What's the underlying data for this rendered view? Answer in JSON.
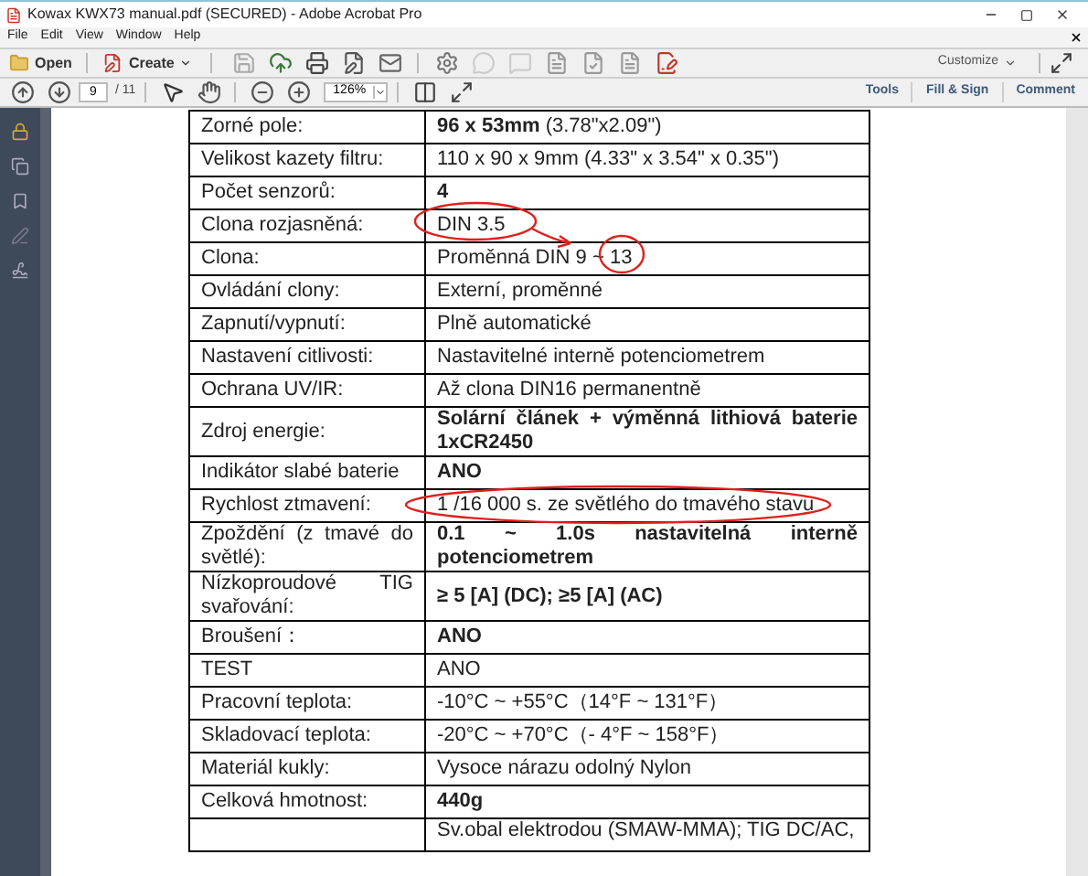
{
  "window": {
    "title": "Kowax KWX73 manual.pdf (SECURED) - Adobe Acrobat Pro"
  },
  "menu": [
    "File",
    "Edit",
    "View",
    "Window",
    "Help"
  ],
  "toolbar": {
    "open": "Open",
    "create": "Create",
    "customize": "Customize"
  },
  "nav": {
    "page": "9",
    "page_count": "/ 11",
    "zoom": "126%"
  },
  "panels": [
    {
      "label": "Tools"
    },
    {
      "label": "Fill & Sign"
    },
    {
      "label": "Comment"
    }
  ],
  "table": {
    "rows": [
      {
        "label": "Zorné pole:",
        "value": "**96 x 53mm** (3.78\"x2.09\")",
        "bold": false
      },
      {
        "label": "Velikost kazety filtru:",
        "value": "110 x 90 x 9mm (4.33\" x 3.54\" x 0.35\")",
        "bold": false
      },
      {
        "label": "Počet senzorů:",
        "value": "4",
        "bold": true
      },
      {
        "label": "Clona rozjasněná:",
        "value": "DIN 3.5",
        "bold": false
      },
      {
        "label": "Clona:",
        "value": "Proměnná DIN 9 ~ 13",
        "bold": false
      },
      {
        "label": "Ovládání clony:",
        "value": "Externí, proměnné",
        "bold": false
      },
      {
        "label": "Zapnutí/vypnutí:",
        "value": "Plně automatické",
        "bold": false
      },
      {
        "label": "Nastavení citlivosti:",
        "value": "Nastavitelné interně potenciometrem",
        "bold": false
      },
      {
        "label": "Ochrana UV/IR:",
        "value": "Až clona DIN16 permanentně",
        "bold": false
      },
      {
        "label": "Zdroj energie:",
        "value": "Solární článek + výměnná lithiová baterie 1xCR2450",
        "bold": true
      },
      {
        "label": "Indikátor slabé baterie",
        "value": "ANO",
        "bold": true
      },
      {
        "label": "Rychlost ztmavení:",
        "value": "1 /16 000 s. ze světlého do tmavého stavu",
        "bold": false
      },
      {
        "label": "Zpoždění (z tmavé do světlé):",
        "value": "0.1 ~ 1.0s nastavitelná interně potenciometrem",
        "bold": true
      },
      {
        "label": "Nízkoproudové TIG svařování:",
        "value": "≥ 5 [A] (DC); ≥5 [A] (AC)",
        "bold": true
      },
      {
        "label": "Broušení：",
        "value": "ANO",
        "bold": true
      },
      {
        "label": "TEST",
        "value": "ANO",
        "bold": false
      },
      {
        "label": "Pracovní teplota:",
        "value": "-10°C ~ +55°C（14°F ~ 131°F）",
        "bold": false
      },
      {
        "label": "Skladovací teplota:",
        "value": "-20°C ~ +70°C（- 4°F ~ 158°F）",
        "bold": false
      },
      {
        "label": "Materiál kukly:",
        "value": "Vysoce nárazu odolný Nylon",
        "bold": false
      },
      {
        "label": "Celková hmotnost:",
        "value": "440g",
        "bold": true
      },
      {
        "value": "Sv.obal elektrodou (SMAW-MMA); TIG DC/AC,",
        "bold": false
      }
    ]
  }
}
